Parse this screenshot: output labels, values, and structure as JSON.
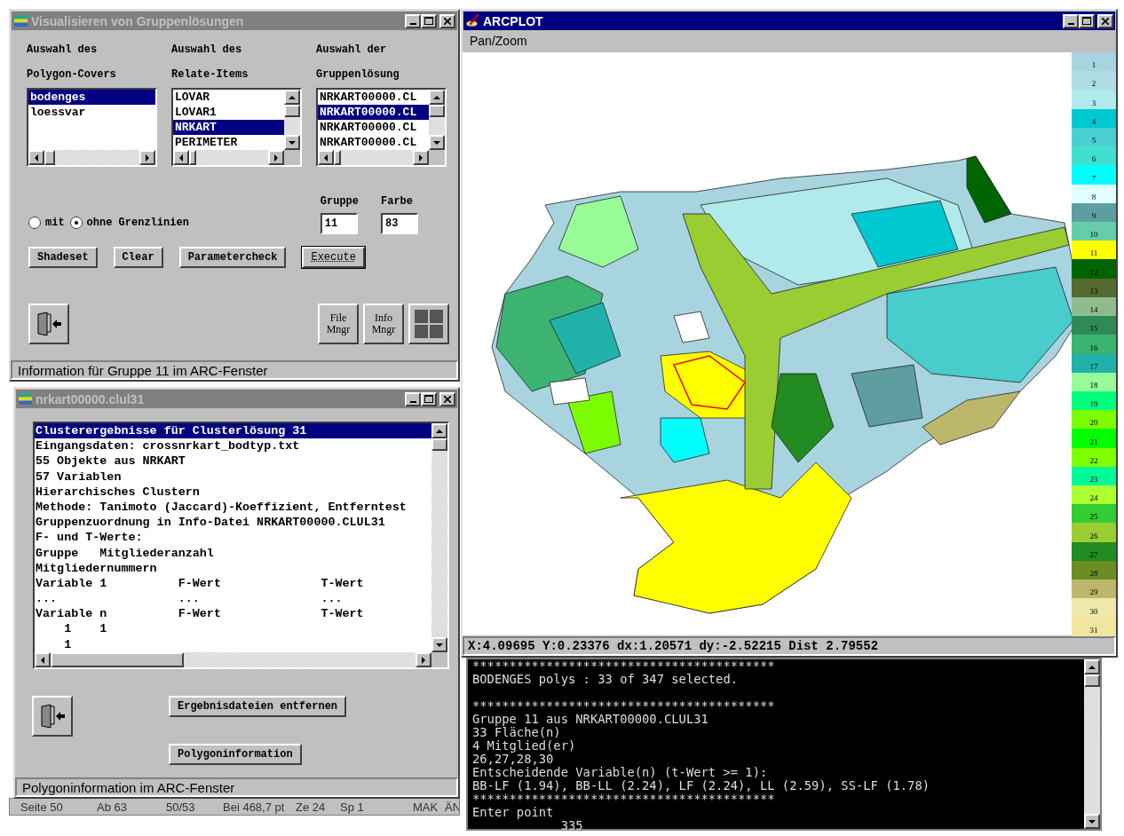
{
  "settings_window": {
    "title": "Visualisieren von Gruppenlösungen",
    "active": false,
    "lists": [
      {
        "heading": [
          "Auswahl des",
          "Polygon-Covers"
        ],
        "vertical_scrollbar": false,
        "items": [
          {
            "label": "bodenges",
            "selected": true
          },
          {
            "label": "loessvar",
            "selected": false
          }
        ]
      },
      {
        "heading": [
          "Auswahl des",
          "Relate-Items"
        ],
        "vertical_scrollbar": true,
        "items": [
          {
            "label": "LOVAR",
            "selected": false
          },
          {
            "label": "LOVAR1",
            "selected": false
          },
          {
            "label": "NRKART",
            "selected": true
          },
          {
            "label": "PERIMETER",
            "selected": false
          }
        ]
      },
      {
        "heading": [
          "Auswahl der",
          "Gruppenlösung"
        ],
        "vertical_scrollbar": true,
        "items": [
          {
            "label": "NRKART00000.CL",
            "selected": false
          },
          {
            "label": "NRKART00000.CL",
            "selected": true
          },
          {
            "label": "NRKART00000.CL",
            "selected": false
          },
          {
            "label": "NRKART00000.CL",
            "selected": false
          }
        ]
      }
    ],
    "boundary_options": [
      {
        "label": "mit",
        "selected": false
      },
      {
        "label": "ohne Grenzlinien",
        "selected": true
      }
    ],
    "fields": [
      {
        "label": "Gruppe",
        "value": "11"
      },
      {
        "label": "Farbe",
        "value": "83"
      }
    ],
    "buttons": [
      {
        "label": "Shadeset",
        "focused": false
      },
      {
        "label": "Clear",
        "focused": false
      },
      {
        "label": "Parametercheck",
        "focused": false
      },
      {
        "label": "Execute",
        "focused": true
      }
    ],
    "tool_buttons": [
      {
        "kind": "exit"
      },
      {
        "kind": "text",
        "lines": [
          "File",
          "Mngr"
        ]
      },
      {
        "kind": "text",
        "lines": [
          "Info",
          "Mngr"
        ]
      },
      {
        "kind": "grid"
      }
    ],
    "status": "Information für Gruppe 11 im ARC-Fenster"
  },
  "results_window": {
    "title": "nrkart00000.clul31",
    "active": false,
    "lines": [
      {
        "text": "Clusterergebnisse für Clusterlösung 31",
        "selected": true
      },
      {
        "text": "Eingangsdaten: crossnrkart_bodtyp.txt",
        "selected": false
      },
      {
        "text": "55 Objekte aus NRKART",
        "selected": false
      },
      {
        "text": "57 Variablen",
        "selected": false
      },
      {
        "text": "Hierarchisches Clustern",
        "selected": false
      },
      {
        "text": "Methode: Tanimoto (Jaccard)-Koeffizient, Entferntest",
        "selected": false
      },
      {
        "text": "Gruppenzuordnung in Info-Datei NRKART00000.CLUL31",
        "selected": false
      },
      {
        "text": "F- und T-Werte:",
        "selected": false
      },
      {
        "text": "Gruppe   Mitgliederanzahl",
        "selected": false
      },
      {
        "text": "Mitgliedernummern",
        "selected": false
      },
      {
        "text": "Variable 1          F-Wert              T-Wert",
        "selected": false
      },
      {
        "text": "...                 ...                 ...",
        "selected": false
      },
      {
        "text": "Variable n          F-Wert              T-Wert",
        "selected": false
      },
      {
        "text": "    1    1",
        "selected": false
      },
      {
        "text": "    1",
        "selected": false
      }
    ],
    "tool_buttons": [
      {
        "kind": "exit"
      }
    ],
    "buttons": [
      "Ergebnisdateien entfernen",
      "Polygoninformation"
    ],
    "status": "Polygoninformation im ARC-Fenster"
  },
  "word_status_bar": [
    "Seite 50",
    "Ab 63",
    "50/53",
    "Bei 468,7 pt",
    "Ze 24",
    "Sp 1",
    "MAK",
    "ÄN"
  ],
  "arcplot_window": {
    "title": "ARCPLOT",
    "active": true,
    "menu": [
      "Pan/Zoom"
    ],
    "legend": [
      {
        "label": "1",
        "color": "#a8d4e0"
      },
      {
        "label": "2",
        "color": "#b0dce4"
      },
      {
        "label": "3",
        "color": "#b0eaea"
      },
      {
        "label": "4",
        "color": "#00c8d0"
      },
      {
        "label": "5",
        "color": "#48d0d0"
      },
      {
        "label": "6",
        "color": "#40e0d0"
      },
      {
        "label": "7",
        "color": "#00ffff"
      },
      {
        "label": "8",
        "color": "#e0ffff"
      },
      {
        "label": "9",
        "color": "#5f9ea0"
      },
      {
        "label": "10",
        "color": "#66cdaa"
      },
      {
        "label": "11",
        "color": "#ffff00"
      },
      {
        "label": "12",
        "color": "#006400"
      },
      {
        "label": "13",
        "color": "#556b2f"
      },
      {
        "label": "14",
        "color": "#8fbc8f"
      },
      {
        "label": "15",
        "color": "#2e8b57"
      },
      {
        "label": "16",
        "color": "#3cb371"
      },
      {
        "label": "17",
        "color": "#20b2aa"
      },
      {
        "label": "18",
        "color": "#98fb98"
      },
      {
        "label": "19",
        "color": "#00ff7f"
      },
      {
        "label": "20",
        "color": "#7cfc00"
      },
      {
        "label": "21",
        "color": "#00ff00"
      },
      {
        "label": "22",
        "color": "#7fff00"
      },
      {
        "label": "23",
        "color": "#00fa9a"
      },
      {
        "label": "24",
        "color": "#adff2f"
      },
      {
        "label": "25",
        "color": "#32cd32"
      },
      {
        "label": "26",
        "color": "#9acd32"
      },
      {
        "label": "27",
        "color": "#228b22"
      },
      {
        "label": "28",
        "color": "#6b8e23"
      },
      {
        "label": "29",
        "color": "#bdb76b"
      },
      {
        "label": "30",
        "color": "#eee8aa"
      },
      {
        "label": "31",
        "color": "#f0e6a0"
      }
    ],
    "coordinates": "X:4.09695 Y:0.23376 dx:1.20571 dy:-2.52215 Dist 2.79552"
  },
  "console": {
    "blocks": [
      [
        "*****************************************",
        "BODENGES polys : 33 of 347 selected."
      ],
      [
        "*****************************************",
        "Gruppe 11 aus NRKART00000.CLUL31",
        "33 Fläche(n)",
        "4 Mitglied(er)",
        "26,27,28,30",
        "Entscheidende Variable(n) (t-Wert >= 1):",
        "BB-LF (1.94), BB-LL (2.24), LF (2.24), LL (2.59), SS-LF (1.78)",
        "*****************************************",
        "Enter point",
        "            335"
      ]
    ]
  }
}
